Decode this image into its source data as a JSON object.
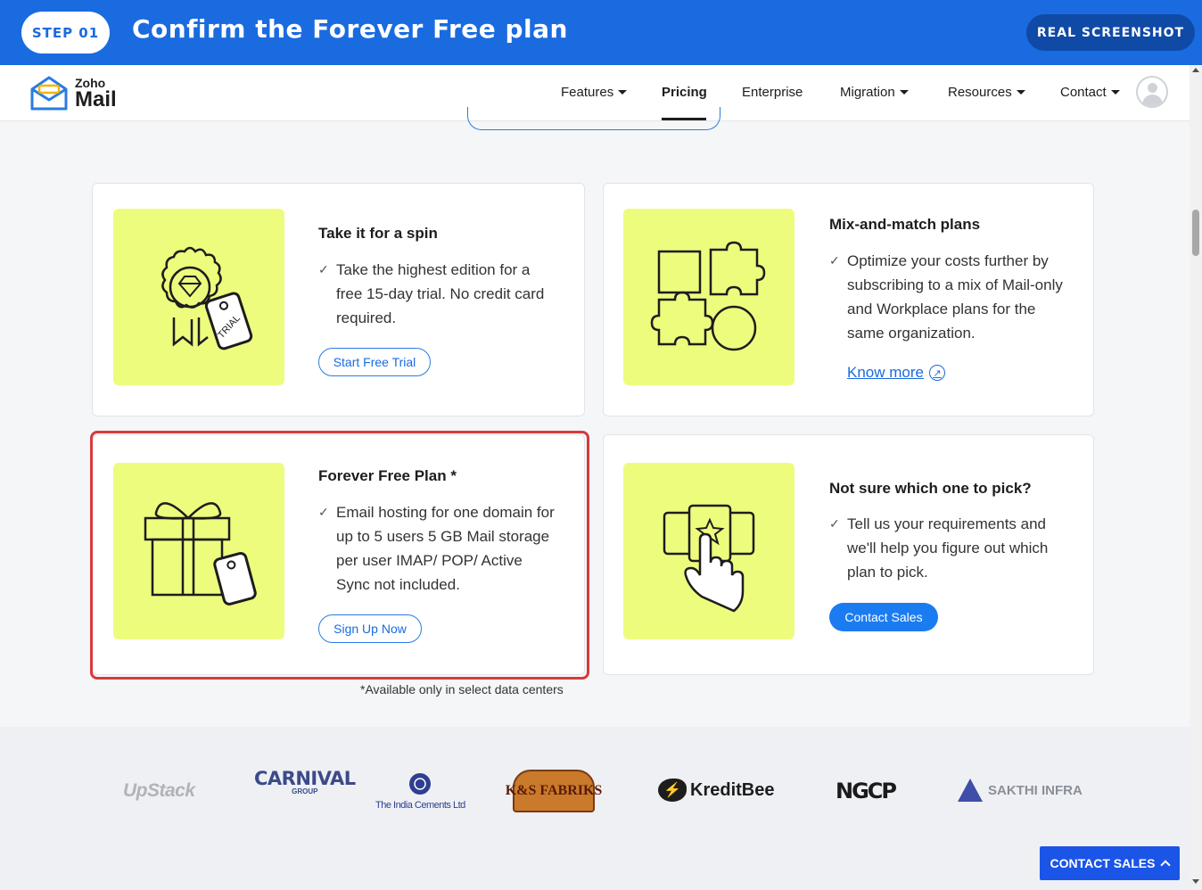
{
  "banner": {
    "step": "STEP 01",
    "title": "Confirm the Forever Free plan",
    "badge": "REAL SCREENSHOT"
  },
  "header": {
    "logo_top": "Zoho",
    "logo_bottom": "Mail",
    "nav": [
      {
        "label": "Features",
        "dropdown": true
      },
      {
        "label": "Pricing",
        "active": true
      },
      {
        "label": "Enterprise"
      },
      {
        "label": "Migration",
        "dropdown": true
      },
      {
        "label": "Resources",
        "dropdown": true
      },
      {
        "label": "Contact",
        "dropdown": true
      }
    ]
  },
  "cards": {
    "spin": {
      "title": "Take it for a spin",
      "text": "Take the highest edition for a free 15-day trial. No credit card required.",
      "button": "Start Free Trial",
      "icon_tag": "TRIAL"
    },
    "mix": {
      "title": "Mix-and-match plans",
      "text": "Optimize your costs further by subscribing to a mix of Mail-only and Workplace plans for the same organization.",
      "link": "Know more"
    },
    "free": {
      "title": "Forever Free Plan *",
      "text": "Email hosting for one domain for up to 5 users 5 GB Mail storage per user IMAP/ POP/ Active Sync not included.",
      "button": "Sign Up Now"
    },
    "pick": {
      "title": "Not sure which one to pick?",
      "text": "Tell us your requirements and we'll help you figure out which plan to pick.",
      "button": "Contact Sales"
    }
  },
  "footnote": "*Available only in select data centers",
  "logos": {
    "upstack": "UpStack",
    "carnival": "CARNIVAL",
    "carnival_sub": "GROUP",
    "cements": "The India Cements Ltd",
    "fabriks": "K&S FABRIKS",
    "kreditbee": "KreditBee",
    "ngcp": "NGCP",
    "sakthi": "SAKTHI INFRA"
  },
  "floating_button": "CONTACT SALES",
  "colors": {
    "banner": "#1a6be0",
    "accent": "#1a7cf0",
    "blob": "#eefc7e",
    "highlight": "#d83a3a"
  }
}
